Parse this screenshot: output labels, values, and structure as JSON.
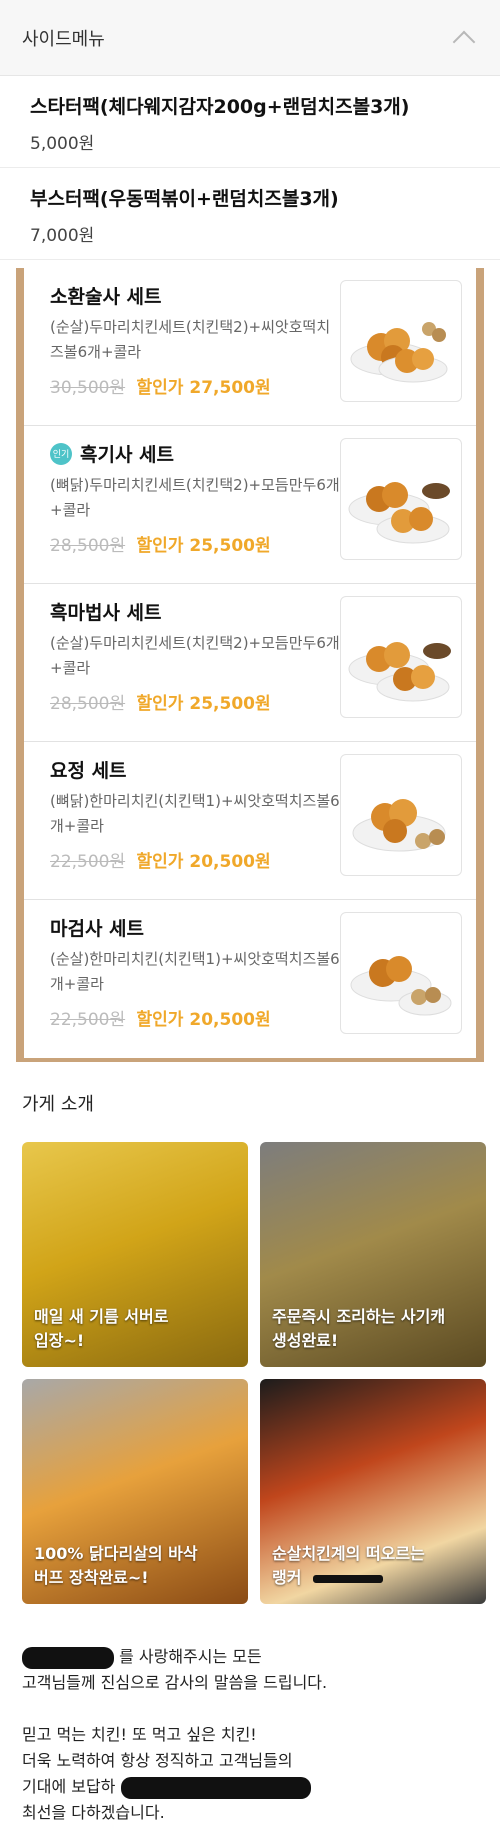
{
  "header": {
    "title": "사이드메뉴",
    "icon": "chevron-up-icon"
  },
  "side_items": [
    {
      "name": "스타터팩(체다웨지감자200g+랜덤치즈볼3개)",
      "price": "5,000원"
    },
    {
      "name": "부스터팩(우동떡볶이+랜덤치즈볼3개)",
      "price": "7,000원"
    }
  ],
  "sets": [
    {
      "name": "소환술사 세트",
      "badge": "",
      "desc1": "(순살)두마리치킨세트(치킨택2)+씨앗호떡치",
      "desc2": "즈볼6개+콜라",
      "old_price": "30,500원",
      "new_price": "할인가 27,500원"
    },
    {
      "name": "흑기사 세트",
      "badge": "인기",
      "desc1": "(뼈닭)두마리치킨세트(치킨택2)+모듬만두6개",
      "desc2": "+콜라",
      "old_price": "28,500원",
      "new_price": "할인가 25,500원"
    },
    {
      "name": "흑마법사 세트",
      "badge": "",
      "desc1": "(순살)두마리치킨세트(치킨택2)+모듬만두6개",
      "desc2": "+콜라",
      "old_price": "28,500원",
      "new_price": "할인가 25,500원"
    },
    {
      "name": "요정 세트",
      "badge": "",
      "desc1": "(뼈닭)한마리치킨(치킨택1)+씨앗호떡치즈볼6",
      "desc2": "개+콜라",
      "old_price": "22,500원",
      "new_price": "할인가 20,500원"
    },
    {
      "name": "마검사 세트",
      "badge": "",
      "desc1": "(순살)한마리치킨(치킨택1)+씨앗호떡치즈볼6",
      "desc2": "개+콜라",
      "old_price": "22,500원",
      "new_price": "할인가 20,500원"
    }
  ],
  "intro": {
    "title": "가게 소개",
    "cards": [
      {
        "line1": "매일 새 기름 서버로",
        "line2": "입장~!"
      },
      {
        "line1": "주문즉시 조리하는 사기캐",
        "line2": "생성완료!"
      },
      {
        "line1": "100% 닭다리살의 바삭",
        "line2": "버프 장착완료~!"
      },
      {
        "line1": "순살치킨계의 떠오르는",
        "line2": "랭커"
      }
    ]
  },
  "outro": {
    "p1_line1": "를 사랑해주시는 모든",
    "p1_line2": "고객님들께 진심으로 감사의 말씀을 드립니다.",
    "p2_line1": "믿고 먹는 치킨! 또 먹고 싶은 치킨!",
    "p2_line2": "더욱 노력하여 항상 정직하고 고객님들의",
    "p2_line3": "기대에 보답하",
    "p2_line4": "최선을 다하겠습니다."
  },
  "colors": {
    "accent": "#f0a82a",
    "badge": "#4ec3c8",
    "frame": "#c9a37a"
  }
}
